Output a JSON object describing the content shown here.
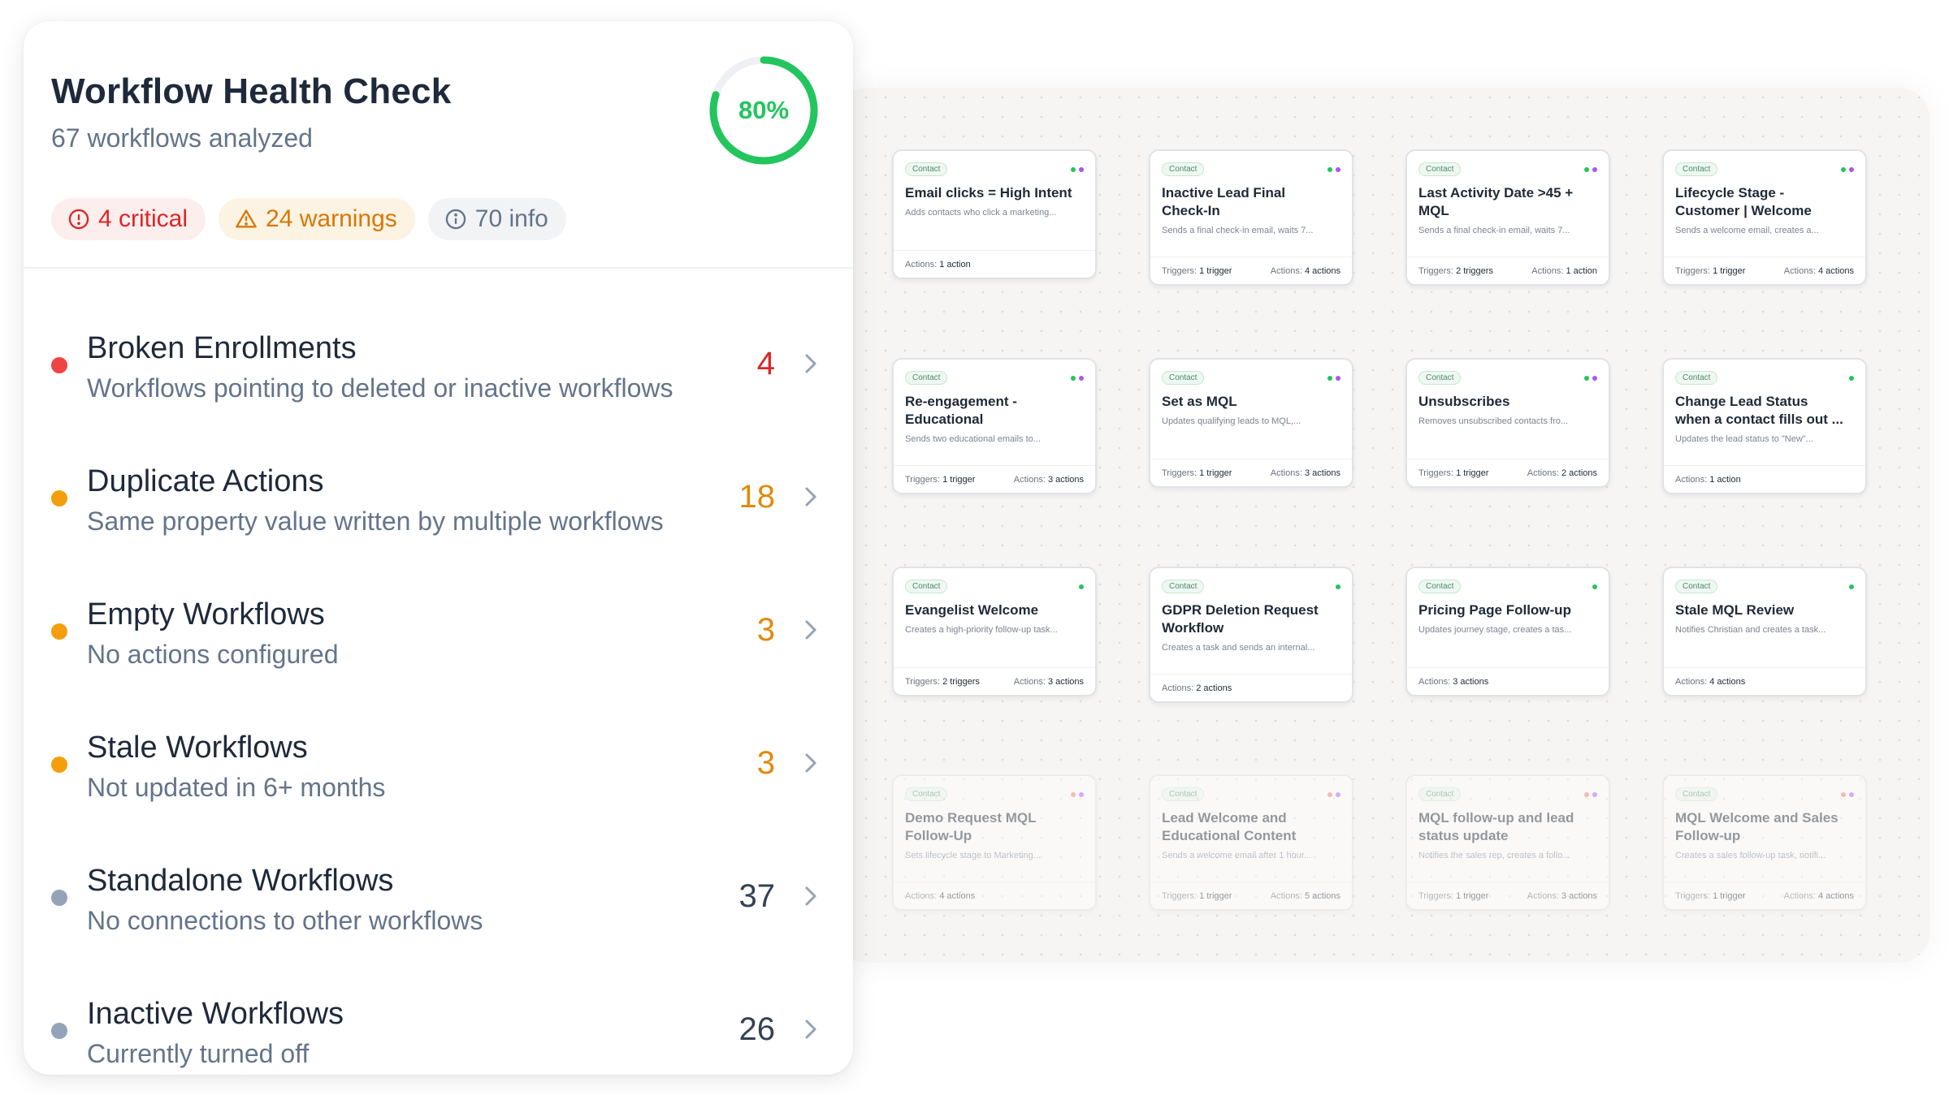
{
  "health": {
    "title": "Workflow Health Check",
    "subtitle": "67 workflows analyzed",
    "score_label": "80%",
    "score_fraction": 0.8,
    "pills": {
      "critical": "4 critical",
      "warnings": "24 warnings",
      "info": "70 info"
    },
    "categories": [
      {
        "title": "Broken Enrollments",
        "description": "Workflows pointing to deleted or inactive workflows",
        "count": "4",
        "dot_color": "#ef4444",
        "count_color": "#dc2626"
      },
      {
        "title": "Duplicate Actions",
        "description": "Same property value written by multiple workflows",
        "count": "18",
        "dot_color": "#f59e0b",
        "count_color": "#e08a0b"
      },
      {
        "title": "Empty Workflows",
        "description": "No actions configured",
        "count": "3",
        "dot_color": "#f59e0b",
        "count_color": "#e08a0b"
      },
      {
        "title": "Stale Workflows",
        "description": "Not updated in 6+ months",
        "count": "3",
        "dot_color": "#f59e0b",
        "count_color": "#e08a0b"
      },
      {
        "title": "Standalone Workflows",
        "description": "No connections to other workflows",
        "count": "37",
        "dot_color": "#94a3b8",
        "count_color": "#334155"
      },
      {
        "title": "Inactive Workflows",
        "description": "Currently turned off",
        "count": "26",
        "dot_color": "#94a3b8",
        "count_color": "#334155"
      }
    ]
  },
  "colors": {
    "accent_green": "#22c55e",
    "critical": "#dc2626",
    "warning": "#d97706",
    "info": "#64748b"
  },
  "workflows": [
    {
      "tag": "Contact",
      "title": "Email clicks = High Intent",
      "desc": "Adds contacts who click a marketing...",
      "triggers": "",
      "actions": "1 action",
      "dots": [
        "g",
        "p"
      ],
      "faded": false
    },
    {
      "tag": "Contact",
      "title": "Inactive Lead Final\nCheck-In",
      "desc": "Sends a final check-in email, waits 7...",
      "triggers": "1 trigger",
      "actions": "4 actions",
      "dots": [
        "g",
        "p"
      ],
      "faded": false
    },
    {
      "tag": "Contact",
      "title": "Last Activity Date >45 +\nMQL",
      "desc": "Sends a final check-in email, waits 7...",
      "triggers": "2 triggers",
      "actions": "1 action",
      "dots": [
        "g",
        "p"
      ],
      "faded": false
    },
    {
      "tag": "Contact",
      "title": "Lifecycle Stage -\nCustomer | Welcome",
      "desc": "Sends a welcome email, creates a...",
      "triggers": "1 trigger",
      "actions": "4 actions",
      "dots": [
        "g",
        "p"
      ],
      "faded": false
    },
    {
      "tag": "Contact",
      "title": "Re-engagement -\nEducational",
      "desc": "Sends two educational emails to...",
      "triggers": "1 trigger",
      "actions": "3 actions",
      "dots": [
        "g",
        "p"
      ],
      "faded": false
    },
    {
      "tag": "Contact",
      "title": "Set as MQL",
      "desc": "Updates qualifying leads to MQL,...",
      "triggers": "1 trigger",
      "actions": "3 actions",
      "dots": [
        "g",
        "p"
      ],
      "faded": false
    },
    {
      "tag": "Contact",
      "title": "Unsubscribes",
      "desc": "Removes unsubscribed contacts fro...",
      "triggers": "1 trigger",
      "actions": "2 actions",
      "dots": [
        "g",
        "p"
      ],
      "faded": false
    },
    {
      "tag": "Contact",
      "title": "Change Lead Status\nwhen a contact fills out ...",
      "desc": "Updates the lead status to \"New\"...",
      "triggers": "",
      "actions": "1 action",
      "dots": [
        "g"
      ],
      "faded": false
    },
    {
      "tag": "Contact",
      "title": "Evangelist Welcome",
      "desc": "Creates a high-priority follow-up task...",
      "triggers": "2 triggers",
      "actions": "3 actions",
      "dots": [
        "g"
      ],
      "faded": false
    },
    {
      "tag": "Contact",
      "title": "GDPR Deletion Request\nWorkflow",
      "desc": "Creates a task and sends an internal...",
      "triggers": "",
      "actions": "2 actions",
      "dots": [
        "g"
      ],
      "faded": false
    },
    {
      "tag": "Contact",
      "title": "Pricing Page Follow-up",
      "desc": "Updates journey stage, creates a tas...",
      "triggers": "",
      "actions": "3 actions",
      "dots": [
        "g"
      ],
      "faded": false
    },
    {
      "tag": "Contact",
      "title": "Stale MQL Review",
      "desc": "Notifies Christian and creates a task...",
      "triggers": "",
      "actions": "4 actions",
      "dots": [
        "g"
      ],
      "faded": false
    },
    {
      "tag": "Contact",
      "title": "Demo Request MQL\nFollow-Up",
      "desc": "Sets lifecycle stage to Marketing...",
      "triggers": "",
      "actions": "4 actions",
      "dots": [
        "r",
        "p"
      ],
      "faded": true
    },
    {
      "tag": "Contact",
      "title": "Lead Welcome and\nEducational Content",
      "desc": "Sends a welcome email after 1 hour...",
      "triggers": "1 trigger",
      "actions": "5 actions",
      "dots": [
        "r",
        "p"
      ],
      "faded": true
    },
    {
      "tag": "Contact",
      "title": "MQL follow-up and lead\nstatus update",
      "desc": "Notifies the sales rep, creates a follo...",
      "triggers": "1 trigger",
      "actions": "3 actions",
      "dots": [
        "r",
        "p"
      ],
      "faded": true
    },
    {
      "tag": "Contact",
      "title": "MQL Welcome and Sales\nFollow-up",
      "desc": "Creates a sales follow-up task, notifi...",
      "triggers": "1 trigger",
      "actions": "4 actions",
      "dots": [
        "r",
        "p"
      ],
      "faded": true
    }
  ],
  "labels": {
    "triggers_prefix": "Triggers:",
    "actions_prefix": "Actions:"
  }
}
